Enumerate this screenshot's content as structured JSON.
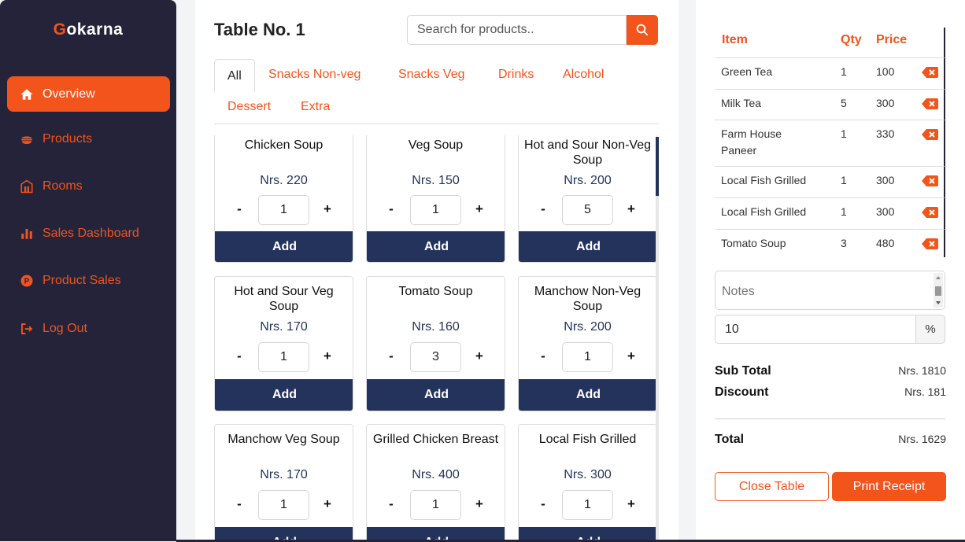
{
  "brand": {
    "first_letter": "G",
    "rest": "okarna",
    "accent": "#f2541b"
  },
  "sidebar": {
    "items": [
      {
        "label": "Overview",
        "icon": "home-icon"
      },
      {
        "label": "Products",
        "icon": "bowl-icon"
      },
      {
        "label": "Rooms",
        "icon": "room-icon"
      },
      {
        "label": "Sales Dashboard",
        "icon": "bar-chart-icon"
      },
      {
        "label": "Product Sales",
        "icon": "coin-icon"
      },
      {
        "label": "Log Out",
        "icon": "logout-icon"
      }
    ]
  },
  "main": {
    "title": "Table No. 1",
    "search_placeholder": "Search for products..",
    "tabs": [
      {
        "label": "All"
      },
      {
        "label": "Snacks Non-veg"
      },
      {
        "label": "Snacks Veg"
      },
      {
        "label": "Drinks"
      },
      {
        "label": "Alcohol"
      },
      {
        "label": "Dessert"
      },
      {
        "label": "Extra"
      }
    ],
    "add_label": "Add",
    "minus": "-",
    "plus": "+",
    "products": [
      {
        "name": "Chicken Soup",
        "price": "Nrs. 220",
        "qty": "1"
      },
      {
        "name": "Veg Soup",
        "price": "Nrs. 150",
        "qty": "1"
      },
      {
        "name": "Hot and Sour Non-Veg Soup",
        "price": "Nrs. 200",
        "qty": "5"
      },
      {
        "name": "Hot and Sour Veg Soup",
        "price": "Nrs. 170",
        "qty": "1"
      },
      {
        "name": "Tomato Soup",
        "price": "Nrs. 160",
        "qty": "3"
      },
      {
        "name": "Manchow Non-Veg Soup",
        "price": "Nrs. 200",
        "qty": "1"
      },
      {
        "name": "Manchow Veg Soup",
        "price": "Nrs. 170",
        "qty": "1"
      },
      {
        "name": "Grilled Chicken Breast",
        "price": "Nrs. 400",
        "qty": "1"
      },
      {
        "name": "Local Fish Grilled",
        "price": "Nrs. 300",
        "qty": "1"
      }
    ]
  },
  "order": {
    "headers": {
      "item": "Item",
      "qty": "Qty",
      "price": "Price"
    },
    "rows": [
      {
        "item": "Green Tea",
        "qty": "1",
        "price": "100"
      },
      {
        "item": "Milk Tea",
        "qty": "5",
        "price": "300"
      },
      {
        "item": "Farm House Paneer",
        "qty": "1",
        "price": "330"
      },
      {
        "item": "Local Fish Grilled",
        "qty": "1",
        "price": "300"
      },
      {
        "item": "Local Fish Grilled",
        "qty": "1",
        "price": "300"
      },
      {
        "item": "Tomato Soup",
        "qty": "3",
        "price": "480"
      }
    ],
    "notes_placeholder": "Notes",
    "discount_value": "10",
    "discount_unit": "%",
    "sub_total_label": "Sub Total",
    "sub_total_value": "Nrs. 1810",
    "discount_label": "Discount",
    "discount_amount": "Nrs. 181",
    "total_label": "Total",
    "total_value": "Nrs. 1629",
    "close_label": "Close Table",
    "print_label": "Print Receipt"
  }
}
